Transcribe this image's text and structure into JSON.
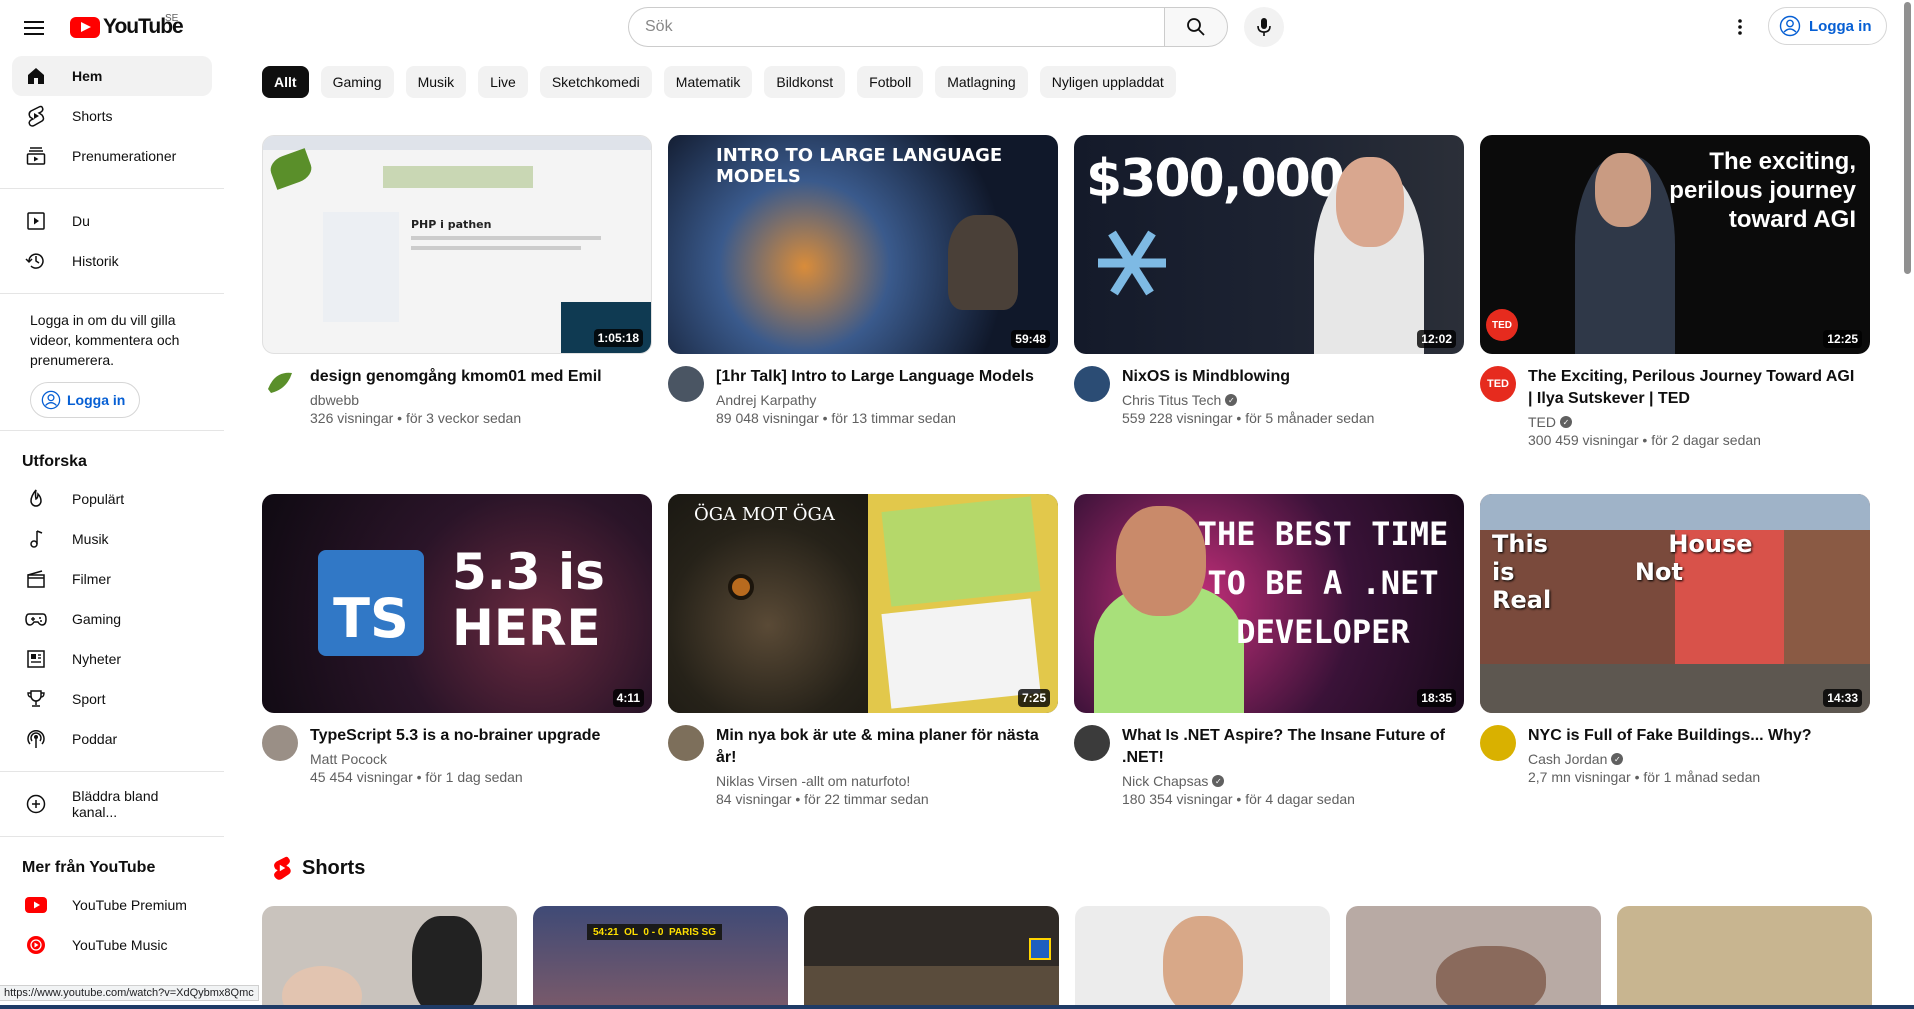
{
  "header": {
    "logo_text": "YouTube",
    "country_code": "SE",
    "search_placeholder": "Sök",
    "signin_label": "Logga in"
  },
  "sidebar": {
    "main": [
      {
        "label": "Hem",
        "icon": "home-icon"
      },
      {
        "label": "Shorts",
        "icon": "shorts-icon"
      },
      {
        "label": "Prenumerationer",
        "icon": "subscriptions-icon"
      }
    ],
    "you": [
      {
        "label": "Du",
        "icon": "library-icon"
      },
      {
        "label": "Historik",
        "icon": "history-icon"
      }
    ],
    "signin_prompt": "Logga in om du vill gilla videor, kommentera och prenumerera.",
    "signin_label": "Logga in",
    "explore_heading": "Utforska",
    "explore": [
      {
        "label": "Populärt",
        "icon": "trending-icon"
      },
      {
        "label": "Musik",
        "icon": "music-icon"
      },
      {
        "label": "Filmer",
        "icon": "movies-icon"
      },
      {
        "label": "Gaming",
        "icon": "gaming-icon"
      },
      {
        "label": "Nyheter",
        "icon": "news-icon"
      },
      {
        "label": "Sport",
        "icon": "trophy-icon"
      },
      {
        "label": "Poddar",
        "icon": "podcast-icon"
      }
    ],
    "browse_channels": "Bläddra bland kanal...",
    "more_heading": "Mer från YouTube",
    "more": [
      {
        "label": "YouTube Premium",
        "icon": "youtube-premium-icon"
      },
      {
        "label": "YouTube Music",
        "icon": "youtube-music-icon"
      }
    ]
  },
  "chips": [
    "Allt",
    "Gaming",
    "Musik",
    "Live",
    "Sketchkomedi",
    "Matematik",
    "Bildkonst",
    "Fotboll",
    "Matlagning",
    "Nyligen uppladdat"
  ],
  "videos": [
    {
      "title": "design genomgång kmom01 med Emil",
      "channel": "dbwebb",
      "verified": false,
      "stats": "326 visningar • för 3 veckor sedan",
      "duration": "1:05:18",
      "overlay": "PHP i pathen",
      "thumb_color": "#f4f4f4",
      "avatar_color": "#5a8f2a"
    },
    {
      "title": "[1hr Talk] Intro to Large Language Models",
      "channel": "Andrej Karpathy",
      "verified": false,
      "stats": "89 048 visningar • för 13 timmar sedan",
      "duration": "59:48",
      "overlay": "INTRO TO LARGE LANGUAGE MODELS",
      "thumb_color": "#1b2a3d",
      "avatar_color": "#4a5563"
    },
    {
      "title": "NixOS is Mindblowing",
      "channel": "Chris Titus Tech",
      "verified": true,
      "stats": "559 228 visningar • för 5 månader sedan",
      "duration": "12:02",
      "overlay": "$300,000",
      "thumb_color": "#1d2230",
      "avatar_color": "#2b4c74"
    },
    {
      "title": "The Exciting, Perilous Journey Toward AGI | Ilya Sutskever | TED",
      "channel": "TED",
      "verified": true,
      "stats": "300 459 visningar • för 2 dagar sedan",
      "duration": "12:25",
      "overlay": "The exciting, perilous journey toward AGI",
      "thumb_color": "#0b0b0b",
      "avatar_color": "#e62b1e",
      "avatar_text": "TED"
    },
    {
      "title": "TypeScript 5.3 is a no-brainer upgrade",
      "channel": "Matt Pocock",
      "verified": false,
      "stats": "45 454 visningar • för 1 dag sedan",
      "duration": "4:11",
      "overlay": "5.3 is HERE",
      "overlay_badge": "TS",
      "thumb_color": "#1a0f1c",
      "avatar_color": "#9a8f86"
    },
    {
      "title": "Min nya bok är ute & mina planer för nästa år!",
      "channel": "Niklas Virsen -allt om naturfoto!",
      "verified": false,
      "stats": "84 visningar • för 22 timmar sedan",
      "duration": "7:25",
      "overlay": "ÖGA MOT ÖGA",
      "thumb_color": "#2c2a22",
      "avatar_color": "#7d6f5b"
    },
    {
      "title": "What Is .NET Aspire? The Insane Future of .NET!",
      "channel": "Nick Chapsas",
      "verified": true,
      "stats": "180 354 visningar • för 4 dagar sedan",
      "duration": "18:35",
      "overlay": "THE BEST TIME TO BE A .NET DEVELOPER",
      "thumb_color": "#2a0f2c",
      "avatar_color": "#3b3b3b"
    },
    {
      "title": "NYC is Full of Fake Buildings... Why?",
      "channel": "Cash Jordan",
      "verified": true,
      "stats": "2,7 mn visningar • för 1 månad sedan",
      "duration": "14:33",
      "overlay": "This House is Not Real",
      "thumb_color": "#7a4a3c",
      "avatar_color": "#d9b100"
    }
  ],
  "shorts": {
    "heading": "Shorts",
    "items": [
      {
        "color": "#c9c3bd"
      },
      {
        "color": "#3f4a76",
        "score": "54:21  OL  0 - 0  PARIS SG"
      },
      {
        "color": "#2f2a26"
      },
      {
        "color": "#ececec"
      },
      {
        "color": "#b8aaa4"
      },
      {
        "color": "#c8b590"
      }
    ]
  },
  "status_url": "https://www.youtube.com/watch?v=XdQybmx8Qmc"
}
